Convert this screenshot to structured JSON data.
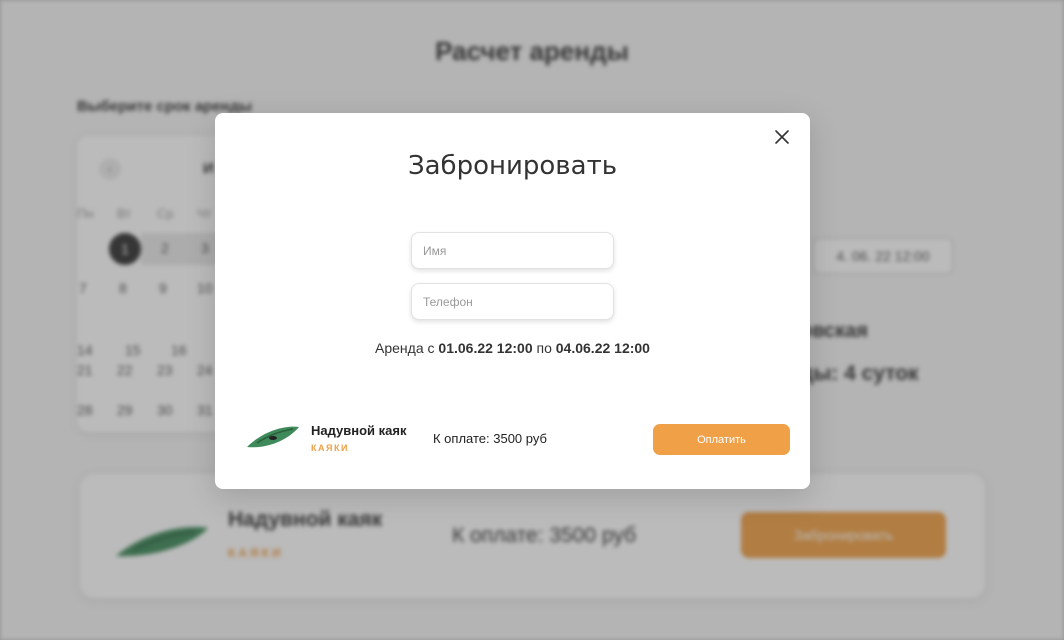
{
  "background": {
    "title": "Расчет аренды",
    "subtitle": "Выберите срок аренды",
    "calendar": {
      "prev_icon": "‹",
      "month_partial": "И",
      "weekdays": [
        "Пн",
        "Вт",
        "Ср",
        "Чт"
      ],
      "dates": [
        "1",
        "2",
        "3",
        "7",
        "8",
        "9",
        "10",
        "14",
        "15",
        "16",
        "21",
        "22",
        "23",
        "24",
        "28",
        "29",
        "30",
        "31"
      ]
    },
    "date_to": "4. 06. 22 12:00",
    "location_partial": "овская",
    "duration_partial": "ды: 4 суток",
    "product": {
      "name": "Надувной каяк",
      "category": "КАЯКИ",
      "price": "К оплате: 3500 руб",
      "book_button": "Забронировать"
    }
  },
  "modal": {
    "title": "Забронировать",
    "name_placeholder": "Имя",
    "phone_placeholder": "Телефон",
    "rental_prefix": "Аренда с ",
    "rental_from": "01.06.22 12:00",
    "rental_mid": " по ",
    "rental_to": "04.06.22 12:00",
    "product": {
      "name": "Надувной каяк",
      "category": "КАЯКИ",
      "price": "К оплате: 3500 руб"
    },
    "pay_button": "Оплатить"
  },
  "colors": {
    "accent": "#f0a046",
    "kayak_green": "#3f8a5a"
  }
}
